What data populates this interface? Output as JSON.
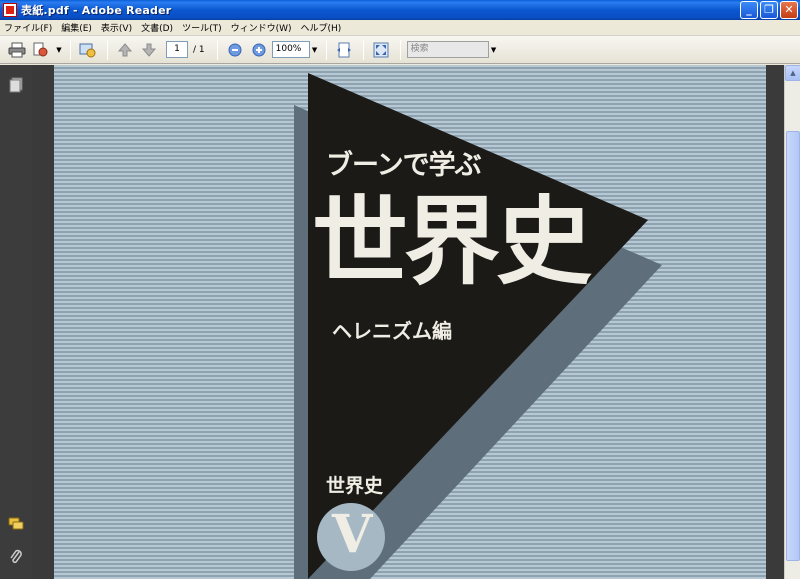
{
  "window": {
    "title": "表紙.pdf - Adobe Reader",
    "buttons": {
      "minimize": "_",
      "maximize": "❐",
      "close": "✕"
    }
  },
  "menu": [
    "ファイル(F)",
    "編集(E)",
    "表示(V)",
    "文書(D)",
    "ツール(T)",
    "ウィンドウ(W)",
    "ヘルプ(H)"
  ],
  "toolbar": {
    "page_current": "1",
    "page_total": "/ 1",
    "zoom": "100%",
    "search_placeholder": "検索"
  },
  "document": {
    "subtitle": "ブーンで学ぶ",
    "title": "世界史",
    "edition": "ヘレニズム編",
    "series_label": "世界史",
    "volume": "V"
  },
  "colors": {
    "triangle": "#1c1a17",
    "shadow": "#5e6f7b",
    "page_text": "#f0ede4",
    "volume_circle": "#a6b8c4"
  }
}
